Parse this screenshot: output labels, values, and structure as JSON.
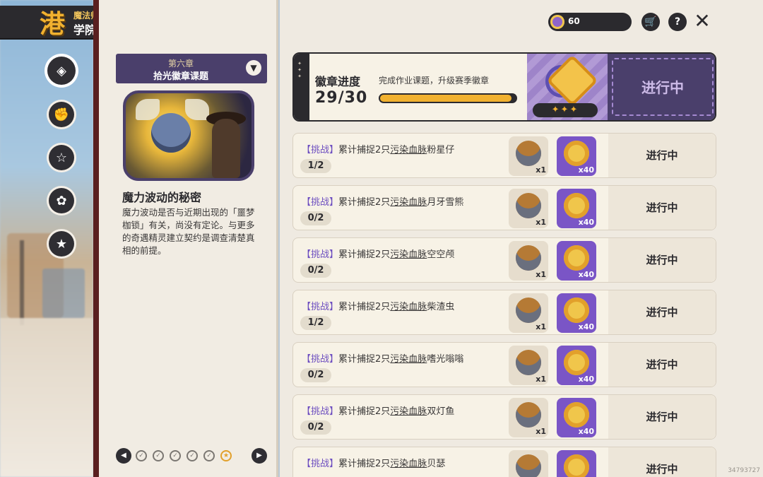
{
  "header": {
    "logo": "港",
    "subtitle": "魔法师手册",
    "title": "学院作业"
  },
  "nav_icons": [
    "assignment-icon",
    "fist-icon",
    "star-badge-icon",
    "paw-icon",
    "book-star-icon"
  ],
  "chapter": {
    "number": "第六章",
    "name": "拾光徽章课题",
    "story_title": "魔力波动的秘密",
    "story_text": "魔力波动是否与近期出现的「噩梦枷锁」有关，尚没有定论。与更多的奇遇精灵建立契约是调查清楚真相的前提。"
  },
  "pager": {
    "dots": 6,
    "current_star_index": 5
  },
  "topbar": {
    "currency_value": "60",
    "shop_icon": "cart-icon",
    "help_label": "?",
    "close_label": "✕"
  },
  "badge_progress": {
    "title": "徽章进度",
    "description": "完成作业课题，升级赛季徽章",
    "progress_text": "29/30",
    "progress_fraction": 0.967,
    "stars": "✦✦✦",
    "status": "进行中"
  },
  "tasks": [
    {
      "tag": "【挑战】",
      "prefix": "累计捕捉2只",
      "u": "污染血脉",
      "name": "粉星仔",
      "progress": "1/2",
      "reward1": "x1",
      "reward2": "x40",
      "status": "进行中"
    },
    {
      "tag": "【挑战】",
      "prefix": "累计捕捉2只",
      "u": "污染血脉",
      "name": "月牙雪熊",
      "progress": "0/2",
      "reward1": "x1",
      "reward2": "x40",
      "status": "进行中"
    },
    {
      "tag": "【挑战】",
      "prefix": "累计捕捉2只",
      "u": "污染血脉",
      "name": "空空颅",
      "progress": "0/2",
      "reward1": "x1",
      "reward2": "x40",
      "status": "进行中"
    },
    {
      "tag": "【挑战】",
      "prefix": "累计捕捉2只",
      "u": "污染血脉",
      "name": "柴渣虫",
      "progress": "1/2",
      "reward1": "x1",
      "reward2": "x40",
      "status": "进行中"
    },
    {
      "tag": "【挑战】",
      "prefix": "累计捕捉2只",
      "u": "污染血脉",
      "name": "嗜光嗡嗡",
      "progress": "0/2",
      "reward1": "x1",
      "reward2": "x40",
      "status": "进行中"
    },
    {
      "tag": "【挑战】",
      "prefix": "累计捕捉2只",
      "u": "污染血脉",
      "name": "双灯鱼",
      "progress": "0/2",
      "reward1": "x1",
      "reward2": "x40",
      "status": "进行中"
    },
    {
      "tag": "【挑战】",
      "prefix": "累计捕捉2只",
      "u": "污染血脉",
      "name": "贝瑟",
      "progress": "",
      "reward1": "",
      "reward2": "",
      "status": "进行中"
    }
  ],
  "uid": "34793727"
}
